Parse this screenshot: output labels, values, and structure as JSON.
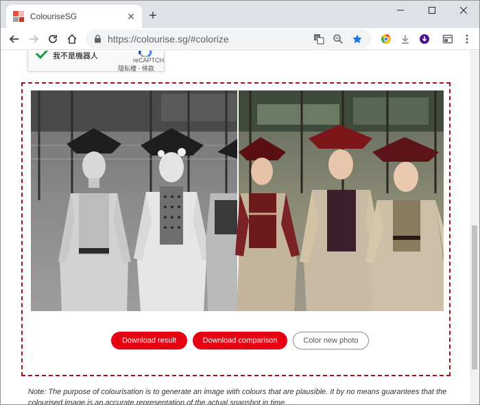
{
  "browser": {
    "tab_title": "ColouriseSG",
    "url_host": "https://colourise.sg",
    "url_path": "/#colorize"
  },
  "recaptcha": {
    "label": "我不是機器人",
    "brand": "reCAPTCH",
    "terms": "隱私權 - 條款"
  },
  "actions": {
    "download_result": "Download result",
    "download_comparison": "Download comparison",
    "color_new_photo": "Color new photo"
  },
  "note": "Note: The purpose of colourisation is to generate an image with colours that are plausible. It by no means guarantees that the colourised image is an accurate representation of the actual snapshot in time.",
  "colors": {
    "accent_red": "#e60012",
    "dashed_border": "#a30f1c",
    "star_blue": "#1a73e8"
  },
  "icons": {
    "back": "arrow-left-icon",
    "forward": "arrow-right-icon",
    "reload": "reload-icon",
    "home": "home-icon",
    "lock": "lock-icon",
    "translate": "translate-icon",
    "zoom": "zoom-icon",
    "bookmark": "star-icon",
    "menu": "kebab-menu-icon"
  }
}
